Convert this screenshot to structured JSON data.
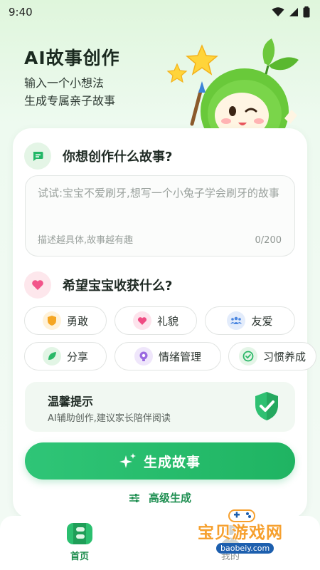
{
  "status_bar": {
    "time": "9:40"
  },
  "hero": {
    "title": "AI故事创作",
    "subtitle_line1": "输入一个小想法",
    "subtitle_line2": "生成专属亲子故事"
  },
  "story_section": {
    "title": "你想创作什么故事?",
    "input": {
      "placeholder": "试试:宝宝不爱刷牙,想写一个小兔子学会刷牙的故事",
      "hint": "描述越具体,故事越有趣",
      "count": "0/200"
    }
  },
  "gain_section": {
    "title": "希望宝宝收获什么?",
    "chips": [
      {
        "label": "勇敢",
        "icon": "shield-icon"
      },
      {
        "label": "礼貌",
        "icon": "heart-icon"
      },
      {
        "label": "友爱",
        "icon": "people-icon"
      },
      {
        "label": "分享",
        "icon": "leaf-icon"
      },
      {
        "label": "情绪管理",
        "icon": "emotion-icon"
      },
      {
        "label": "习惯养成",
        "icon": "check-circle-icon"
      }
    ]
  },
  "tip": {
    "title": "温馨提示",
    "text": "AI辅助创作,建议家长陪伴阅读"
  },
  "actions": {
    "generate_label": "生成故事",
    "advanced_label": "高级生成"
  },
  "bottom_nav": {
    "home_label": "首页",
    "mine_label": "我的"
  },
  "watermark": {
    "text": "宝贝游戏网",
    "url": "baobeiy.com"
  },
  "colors": {
    "primary": "#21b866",
    "primary_dark": "#1b8c4c",
    "background": "#e6f7e6",
    "card": "#ffffff"
  }
}
